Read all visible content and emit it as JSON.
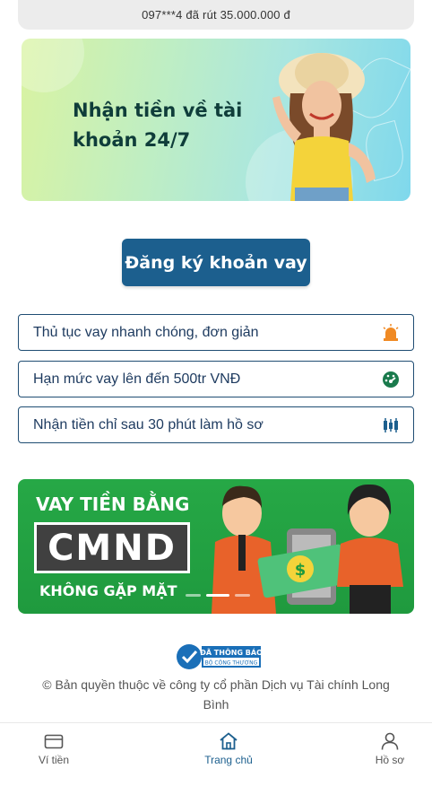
{
  "ticker": {
    "text": "097***4 đã rút 35.000.000 đ"
  },
  "hero_banner": {
    "headline_line1": "Nhận tiền về tài",
    "headline_line2": "khoản 24/7"
  },
  "cta": {
    "label": "Đăng ký khoản vay"
  },
  "features": [
    {
      "label": "Thủ tục vay nhanh chóng, đơn giản",
      "icon": "siren-icon",
      "color": "#f08a24"
    },
    {
      "label": "Hạn mức vay lên đến 500tr VNĐ",
      "icon": "speedometer-icon",
      "color": "#1a7a4c"
    },
    {
      "label": "Nhận tiền chỉ sau 30 phút làm hồ sơ",
      "icon": "candlestick-icon",
      "color": "#1c5f8e"
    }
  ],
  "promo_banner": {
    "line1": "VAY TIỀN BẰNG",
    "line2": "CMND",
    "line3": "KHÔNG GẶP MẶT",
    "slide_count": 3,
    "active_slide": 2
  },
  "badge": {
    "line1": "ĐÃ THÔNG BÁO",
    "line2": "BỘ CÔNG THƯƠNG"
  },
  "footer": {
    "copyright": "© Bản quyền thuộc về công ty cổ phần Dịch vụ Tài chính Long Bình"
  },
  "tabbar": {
    "tabs": [
      {
        "label": "Ví tiền",
        "icon": "wallet-icon"
      },
      {
        "label": "Trang chủ",
        "icon": "home-icon",
        "active": true
      },
      {
        "label": "Hồ sơ",
        "icon": "user-icon"
      }
    ]
  },
  "colors": {
    "primary": "#1c5f8e",
    "promo_green": "#26a846",
    "accent_orange": "#f08a24"
  }
}
